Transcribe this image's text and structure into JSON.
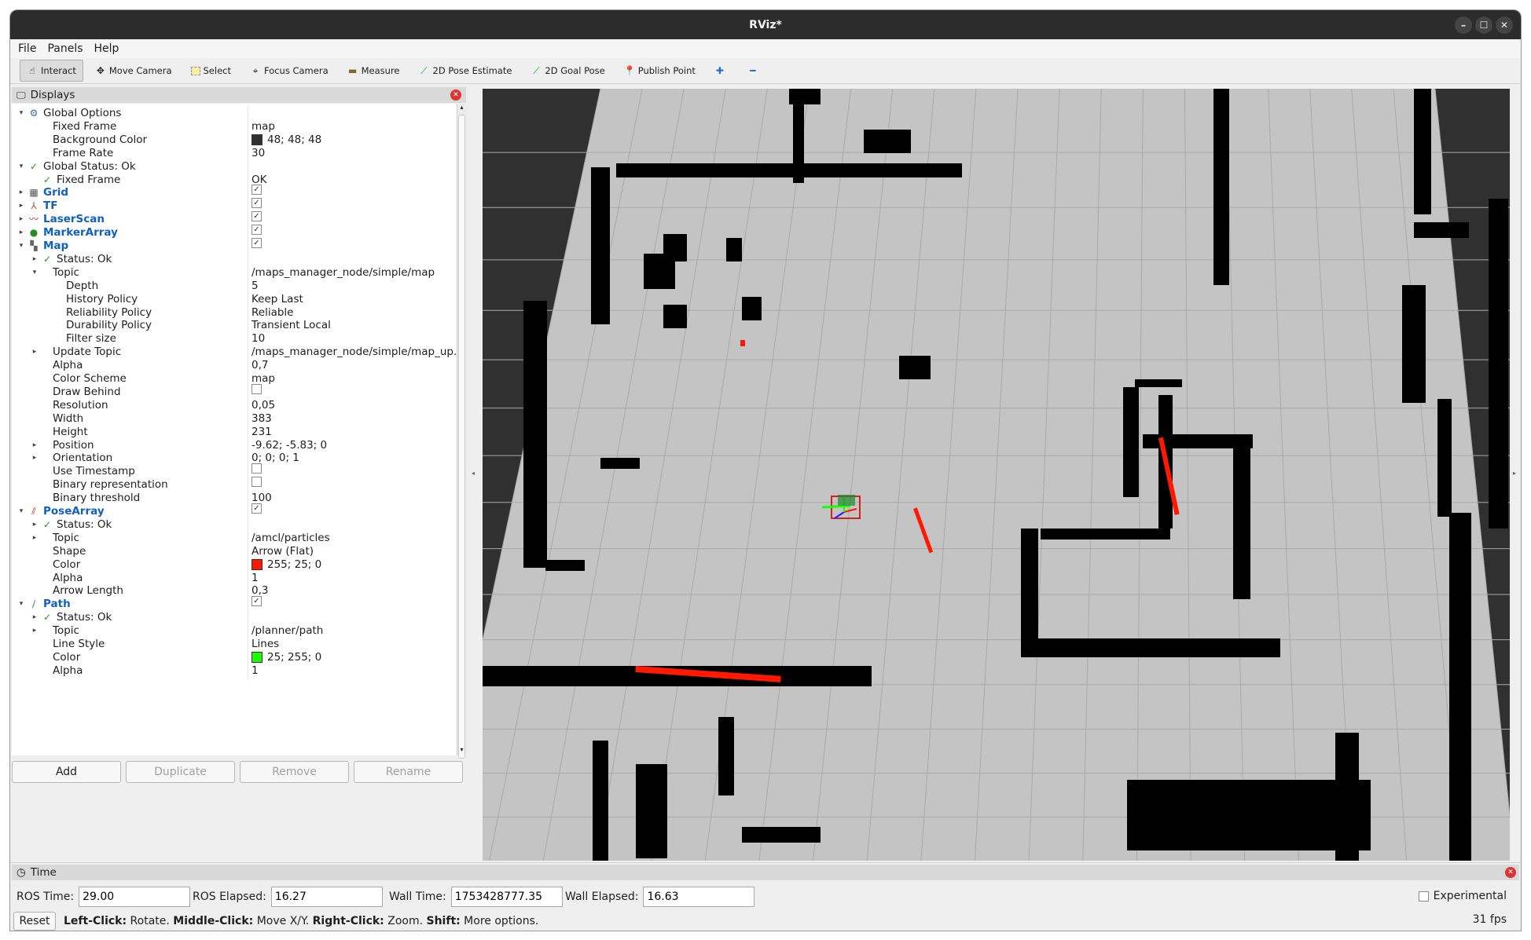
{
  "window": {
    "title": "RViz*",
    "controls": [
      "–",
      "☐",
      "✕"
    ]
  },
  "menu": [
    "File",
    "Panels",
    "Help"
  ],
  "toolbar": [
    {
      "label": "Interact",
      "icon": "hand-icon",
      "active": true
    },
    {
      "label": "Move Camera",
      "icon": "move-camera-icon"
    },
    {
      "label": "Select",
      "icon": "select-icon"
    },
    {
      "label": "Focus Camera",
      "icon": "focus-camera-icon"
    },
    {
      "label": "Measure",
      "icon": "measure-icon"
    },
    {
      "label": "2D Pose Estimate",
      "icon": "pose-estimate-icon"
    },
    {
      "label": "2D Goal Pose",
      "icon": "goal-pose-icon"
    },
    {
      "label": "Publish Point",
      "icon": "publish-point-icon"
    }
  ],
  "displays": {
    "title": "Displays",
    "rows": [
      {
        "indent": 0,
        "arrow": "▾",
        "icon": "⚙",
        "icolor": "#3a6ea5",
        "label": "Global Options"
      },
      {
        "indent": 1,
        "label": "Fixed Frame",
        "value": "map"
      },
      {
        "indent": 1,
        "label": "Background Color",
        "value": "48; 48; 48",
        "swatch": "#303030"
      },
      {
        "indent": 1,
        "label": "Frame Rate",
        "value": "30"
      },
      {
        "indent": 0,
        "arrow": "▾",
        "icon": "✓",
        "icolor": "#1a9a1a",
        "label": "Global Status: Ok"
      },
      {
        "indent": 1,
        "icon": "✓",
        "icolor": "#1a9a1a",
        "label": "Fixed Frame",
        "value": "OK"
      },
      {
        "indent": 0,
        "arrow": "▸",
        "icon": "▦",
        "icolor": "#555",
        "label": "Grid",
        "blue": true,
        "check": true
      },
      {
        "indent": 0,
        "arrow": "▸",
        "icon": "⅄",
        "icolor": "#c05020",
        "label": "TF",
        "blue": true,
        "check": true
      },
      {
        "indent": 0,
        "arrow": "▸",
        "icon": "〰",
        "icolor": "#d02020",
        "label": "LaserScan",
        "blue": true,
        "check": true
      },
      {
        "indent": 0,
        "arrow": "▸",
        "icon": "●",
        "icolor": "#2a8a2a",
        "label": "MarkerArray",
        "blue": true,
        "check": true
      },
      {
        "indent": 0,
        "arrow": "▾",
        "icon": "▚",
        "icolor": "#666",
        "label": "Map",
        "blue": true,
        "check": true
      },
      {
        "indent": 1,
        "arrow": "▸",
        "icon": "✓",
        "icolor": "#1a9a1a",
        "label": "Status: Ok"
      },
      {
        "indent": 1,
        "arrow": "▾",
        "label": "Topic",
        "value": "/maps_manager_node/simple/map"
      },
      {
        "indent": 2,
        "label": "Depth",
        "value": "5"
      },
      {
        "indent": 2,
        "label": "History Policy",
        "value": "Keep Last"
      },
      {
        "indent": 2,
        "label": "Reliability Policy",
        "value": "Reliable"
      },
      {
        "indent": 2,
        "label": "Durability Policy",
        "value": "Transient Local"
      },
      {
        "indent": 2,
        "label": "Filter size",
        "value": "10"
      },
      {
        "indent": 1,
        "arrow": "▸",
        "label": "Update Topic",
        "value": "/maps_manager_node/simple/map_up..."
      },
      {
        "indent": 1,
        "label": "Alpha",
        "value": "0,7"
      },
      {
        "indent": 1,
        "label": "Color Scheme",
        "value": "map"
      },
      {
        "indent": 1,
        "label": "Draw Behind",
        "check": false
      },
      {
        "indent": 1,
        "label": "Resolution",
        "value": "0,05"
      },
      {
        "indent": 1,
        "label": "Width",
        "value": "383"
      },
      {
        "indent": 1,
        "label": "Height",
        "value": "231"
      },
      {
        "indent": 1,
        "arrow": "▸",
        "label": "Position",
        "value": "-9.62; -5.83; 0"
      },
      {
        "indent": 1,
        "arrow": "▸",
        "label": "Orientation",
        "value": "0; 0; 0; 1"
      },
      {
        "indent": 1,
        "label": "Use Timestamp",
        "check": false
      },
      {
        "indent": 1,
        "label": "Binary representation",
        "check": false
      },
      {
        "indent": 1,
        "label": "Binary threshold",
        "value": "100"
      },
      {
        "indent": 0,
        "arrow": "▾",
        "icon": "⫽",
        "icolor": "#d02020",
        "label": "PoseArray",
        "blue": true,
        "check": true
      },
      {
        "indent": 1,
        "arrow": "▸",
        "icon": "✓",
        "icolor": "#1a9a1a",
        "label": "Status: Ok"
      },
      {
        "indent": 1,
        "arrow": "▸",
        "label": "Topic",
        "value": "/amcl/particles"
      },
      {
        "indent": 1,
        "label": "Shape",
        "value": "Arrow (Flat)"
      },
      {
        "indent": 1,
        "label": "Color",
        "value": "255; 25; 0",
        "swatch": "#ff1900"
      },
      {
        "indent": 1,
        "label": "Alpha",
        "value": "1"
      },
      {
        "indent": 1,
        "label": "Arrow Length",
        "value": "0,3"
      },
      {
        "indent": 0,
        "arrow": "▾",
        "icon": "∕",
        "icolor": "#1a9a1a",
        "label": "Path",
        "blue": true,
        "check": true
      },
      {
        "indent": 1,
        "arrow": "▸",
        "icon": "✓",
        "icolor": "#1a9a1a",
        "label": "Status: Ok"
      },
      {
        "indent": 1,
        "arrow": "▸",
        "label": "Topic",
        "value": "/planner/path"
      },
      {
        "indent": 1,
        "label": "Line Style",
        "value": "Lines"
      },
      {
        "indent": 1,
        "label": "Color",
        "value": "25; 255; 0",
        "swatch": "#19ff00"
      },
      {
        "indent": 1,
        "label": "Alpha",
        "value": "1"
      }
    ],
    "buttons": [
      {
        "label": "Add",
        "disabled": false
      },
      {
        "label": "Duplicate",
        "disabled": true
      },
      {
        "label": "Remove",
        "disabled": true
      },
      {
        "label": "Rename",
        "disabled": true
      }
    ]
  },
  "time": {
    "title": "Time",
    "ros_time_label": "ROS Time:",
    "ros_time": "29.00",
    "ros_elapsed_label": "ROS Elapsed:",
    "ros_elapsed": "16.27",
    "wall_time_label": "Wall Time:",
    "wall_time": "1753428777.35",
    "wall_elapsed_label": "Wall Elapsed:",
    "wall_elapsed": "16.63",
    "experimental": "Experimental",
    "reset": "Reset",
    "hint_left_key": "Left-Click:",
    "hint_left": " Rotate. ",
    "hint_mid_key": "Middle-Click:",
    "hint_mid": " Move X/Y. ",
    "hint_right_key": "Right-Click:",
    "hint_right": " Zoom. ",
    "hint_shift_key": "Shift:",
    "hint_shift": " More options.",
    "fps": "31 fps"
  },
  "colors": {
    "background": "#303030",
    "map_free": "#c4c4c4",
    "map_occupied": "#000000",
    "laser": "#ff1900",
    "path": "#19ff00"
  }
}
